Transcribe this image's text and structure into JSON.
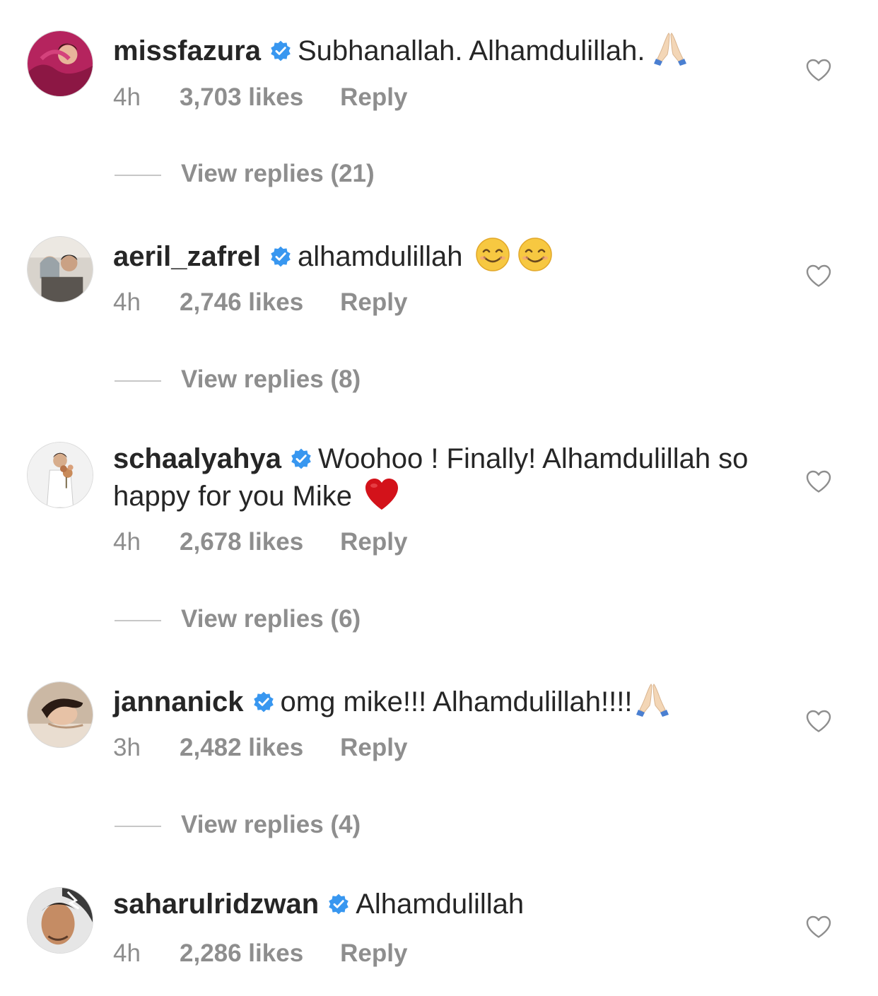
{
  "comments": [
    {
      "username": "missfazura",
      "text": "Subhanallah. Alhamdulillah.",
      "emoji": "folded-hands",
      "time": "4h",
      "likes": "3,703 likes",
      "reply": "Reply",
      "view_replies": "View replies (21)"
    },
    {
      "username": "aeril_zafrel",
      "text": "alhamdulillah",
      "emoji": "smiling-face-x2",
      "time": "4h",
      "likes": "2,746 likes",
      "reply": "Reply",
      "view_replies": "View replies (8)"
    },
    {
      "username": "schaalyahya",
      "text": "Woohoo ! Finally! Alhamdulillah so happy for you Mike",
      "emoji": "red-heart",
      "time": "4h",
      "likes": "2,678 likes",
      "reply": "Reply",
      "view_replies": "View replies (6)"
    },
    {
      "username": "jannanick",
      "text": "omg mike!!! Alhamdulillah!!!!",
      "emoji": "folded-hands",
      "time": "3h",
      "likes": "2,482 likes",
      "reply": "Reply",
      "view_replies": "View replies (4)"
    },
    {
      "username": "saharulridzwan",
      "text": "Alhamdulillah",
      "time": "4h",
      "likes": "2,286 likes",
      "reply": "Reply"
    }
  ],
  "colors": {
    "verified": "#3897f0",
    "meta_text": "#8e8e8e",
    "username": "#262626"
  }
}
